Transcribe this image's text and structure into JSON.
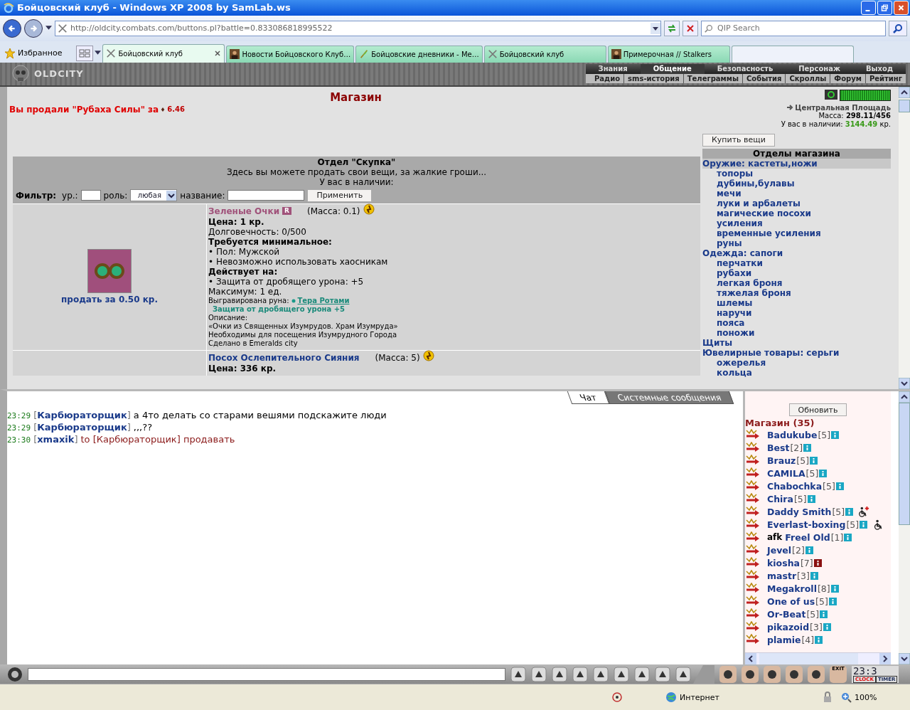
{
  "window": {
    "title": "Бойцовский клуб - Windows XP 2008 by SamLab.ws"
  },
  "address": {
    "url": "http://oldcity.combats.com/buttons.pl?battle=0.833086818995522",
    "search_placeholder": "QIP Search"
  },
  "favorites": {
    "label": "Избранное"
  },
  "tabs": [
    {
      "label": "Бойцовский клуб",
      "selected": true,
      "kind": "swords"
    },
    {
      "label": "Новости Бойцовского Клуб…",
      "selected": false,
      "kind": "avatar"
    },
    {
      "label": "Бойцовские дневники - Ме…",
      "selected": false,
      "kind": "quill"
    },
    {
      "label": "Бойцовский клуб",
      "selected": false,
      "kind": "swords"
    },
    {
      "label": "Примерочная // Stalkers",
      "selected": false,
      "kind": "avatar"
    }
  ],
  "game_header": {
    "logo": "OLDCITY",
    "menu": [
      {
        "label": "Знания",
        "selected": false
      },
      {
        "label": "Общение",
        "selected": true
      },
      {
        "label": "Безопасность",
        "selected": false
      },
      {
        "label": "Персонаж",
        "selected": false
      },
      {
        "label": "Выход",
        "selected": false
      }
    ],
    "submenu": [
      "Радио",
      "sms-история",
      "Телеграммы",
      "События",
      "Скроллы",
      "Форум",
      "Рейтинг"
    ]
  },
  "shop": {
    "title": "Магазин",
    "sold_message": "Вы продали \"Рубаха Силы\" за",
    "sold_amount": "6.46",
    "location": "Центральная Площадь",
    "mass_label": "Масса:",
    "mass": "298.11/456",
    "money_label": "У вас в наличии:",
    "money": "3144.49",
    "money_unit": "кр.",
    "department": {
      "title": "Отдел \"Скупка\"",
      "subtitle": "Здесь вы можете продать свои вещи, за жалкие гроши...",
      "have_label": "У вас в наличии:"
    },
    "filter": {
      "label": "Фильтр:",
      "level_label": "ур.:",
      "role_label": "роль:",
      "role_value": "любая",
      "name_label": "название:",
      "apply": "Применить"
    },
    "items": [
      {
        "name": "Зеленые Очки",
        "color": "#a0527a",
        "badge": "R",
        "mass": "(Масса: 0.1)",
        "sell": "продать за 0.50 кр.",
        "has_image": true,
        "lines": [
          {
            "kind": "bold",
            "text": "Цена: 1 кр."
          },
          {
            "kind": "text",
            "text": "Долговечность: 0/500"
          },
          {
            "kind": "bold",
            "text": "Требуется минимальное:"
          },
          {
            "kind": "text",
            "text": "• Пол: Мужской"
          },
          {
            "kind": "text",
            "text": "• Невозможно использовать хаосникам"
          },
          {
            "kind": "bold",
            "text": "Действует на:"
          },
          {
            "kind": "text",
            "text": "• Защита от дробящего урона: +5"
          },
          {
            "kind": "text",
            "text": "Максимум: 1 ед."
          },
          {
            "kind": "rune",
            "text": "Выгравирована руна:",
            "link": "Тера Ротами"
          },
          {
            "kind": "rune_effect",
            "text": "Защита от дробящего урона +5"
          },
          {
            "kind": "small",
            "text": "Описание:"
          },
          {
            "kind": "small",
            "text": "«Очки из Священных Изумрудов. Храм Изумруда»"
          },
          {
            "kind": "small",
            "text": "Необходимы для посещения Изумрудного Города"
          },
          {
            "kind": "small",
            "text": "Сделано в Emeralds city"
          }
        ]
      },
      {
        "name": "Посох Ослепительного Сияния",
        "color": "#1a3a8a",
        "mass": "(Масса: 5)",
        "has_image": false,
        "lines": [
          {
            "kind": "bold",
            "text": "Цена: 336 кр."
          }
        ]
      }
    ],
    "buy_button": "Купить вещи",
    "sections_title": "Отделы магазина",
    "categories": [
      {
        "label": "Оружие: кастеты,ножи",
        "selected": true,
        "children": [
          {
            "label": "топоры",
            "selected": false
          },
          {
            "label": "дубины,булавы",
            "selected": false
          },
          {
            "label": "мечи",
            "selected": false
          },
          {
            "label": "луки и арбалеты",
            "selected": false
          },
          {
            "label": "магические посохи",
            "selected": false
          },
          {
            "label": "усиления",
            "selected": false
          },
          {
            "label": "временные усиления",
            "selected": false
          },
          {
            "label": "руны",
            "selected": false
          }
        ]
      },
      {
        "label": "Одежда: сапоги",
        "selected": false,
        "children": [
          {
            "label": "перчатки",
            "selected": false
          },
          {
            "label": "рубахи",
            "selected": false
          },
          {
            "label": "легкая броня",
            "selected": false
          },
          {
            "label": "тяжелая броня",
            "selected": false
          },
          {
            "label": "шлемы",
            "selected": false
          },
          {
            "label": "наручи",
            "selected": false
          },
          {
            "label": "пояса",
            "selected": false
          },
          {
            "label": "поножи",
            "selected": false
          }
        ]
      },
      {
        "label": "Щиты",
        "selected": false
      },
      {
        "label": "Ювелирные товары: серьги",
        "selected": false,
        "children": [
          {
            "label": "ожерелья",
            "selected": false
          },
          {
            "label": "кольца",
            "selected": false
          }
        ]
      }
    ]
  },
  "chat": {
    "tabs": [
      {
        "label": "Чат",
        "selected": true
      },
      {
        "label": "Системные сообщения",
        "selected": false
      }
    ],
    "messages": [
      {
        "time": "23:29",
        "sender": "[**Карбюраторщик**]",
        "text": "а 4то делать со старами вешями подскажите люди",
        "private": false
      },
      {
        "time": "23:29",
        "sender": "[**Карбюраторщик**]",
        "text": ",,,??",
        "private": false
      },
      {
        "time": "23:30",
        "sender": "[**xmaxik**]",
        "text": "to [Карбюраторщик] продавать",
        "private": true
      }
    ]
  },
  "online": {
    "refresh": "Обновить",
    "title": "Магазин (35)",
    "users": [
      {
        "name": "Badukube",
        "level": "[5]",
        "color": "#19a7c4",
        "kind": "plain"
      },
      {
        "name": "Best",
        "level": "[2]",
        "color": "#19a7c4",
        "kind": "plain"
      },
      {
        "name": "Brauz",
        "level": "[5]",
        "color": "#19a7c4",
        "kind": "plain"
      },
      {
        "name": "CAMILA",
        "level": "[5]",
        "color": "#19a7c4",
        "kind": "plain"
      },
      {
        "name": "Chabochka",
        "level": "[5]",
        "color": "#19a7c4",
        "kind": "plain"
      },
      {
        "name": "Chira",
        "level": "[5]",
        "color": "#19a7c4",
        "kind": "plain"
      },
      {
        "name": "Daddy Smith",
        "level": "[5]",
        "color": "#19a7c4",
        "kind": "wounded"
      },
      {
        "name": "Everlast-boxing",
        "level": "[5]",
        "color": "#19a7c4",
        "kind": "injured"
      },
      {
        "prefix": "afk",
        "name": "Freel Old",
        "level": "[1]",
        "color": "#19a7c4",
        "kind": "plain"
      },
      {
        "name": "Jevel",
        "level": "[2]",
        "color": "#19a7c4",
        "kind": "plain"
      },
      {
        "name": "kiosha",
        "level": "[7]",
        "color": "#8a1010",
        "kind": "plain"
      },
      {
        "name": "mastr",
        "level": "[3]",
        "color": "#19a7c4",
        "kind": "plain"
      },
      {
        "name": "Megakroll",
        "level": "[8]",
        "color": "#19a7c4",
        "kind": "plain"
      },
      {
        "name": "One of us",
        "level": "[5]",
        "color": "#19a7c4",
        "kind": "plain"
      },
      {
        "name": "Or-Beat",
        "level": "[5]",
        "color": "#19a7c4",
        "kind": "plain"
      },
      {
        "name": "pikazoid",
        "level": "[3]",
        "color": "#19a7c4",
        "kind": "plain"
      },
      {
        "name": "plamie",
        "level": "[4]",
        "color": "#19a7c4",
        "kind": "plain"
      }
    ]
  },
  "toolbar": {
    "exit_label": "EXIT",
    "clock": "23:3",
    "clock_label": "CLOCK",
    "timer_label": "TIMER"
  },
  "status_bar": {
    "zone": "Интернет",
    "zoom": "100%"
  }
}
